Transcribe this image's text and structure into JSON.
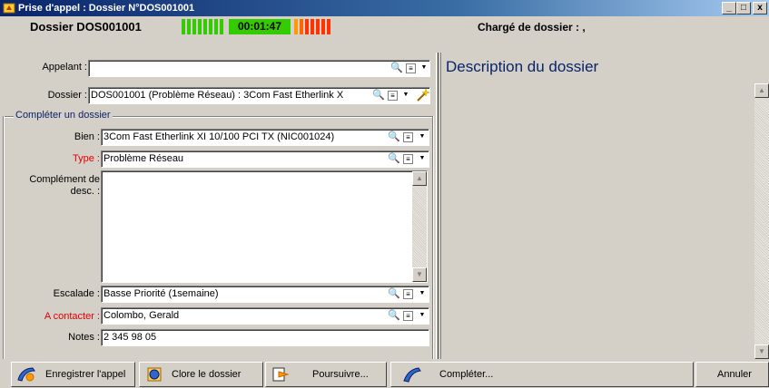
{
  "window": {
    "title": "Prise d'appel : Dossier N°DOS001001",
    "buttons": {
      "minimize": "_",
      "maximize": "□",
      "close": "x"
    }
  },
  "header": {
    "dossier_label": "Dossier DOS001001",
    "timer": "00:01:47",
    "charge_label": "Chargé de dossier : ,"
  },
  "form": {
    "appelant": {
      "label": "Appelant :",
      "value": ""
    },
    "dossier": {
      "label": "Dossier :",
      "value": "DOS001001 (Problème Réseau) : 3Com Fast Etherlink X"
    },
    "group_title": "Compléter un dossier",
    "bien": {
      "label": "Bien :",
      "value": "3Com Fast Etherlink XI 10/100 PCI TX (NIC001024)"
    },
    "type": {
      "label": "Type :",
      "value": "Problème Réseau"
    },
    "complement": {
      "label_line1": "Complément de",
      "label_line2": "desc. :",
      "value": ""
    },
    "escalade": {
      "label": "Escalade :",
      "value": "Basse Priorité (1semaine)"
    },
    "contacter": {
      "label": "A contacter :",
      "value": "Colombo, Gerald"
    },
    "notes": {
      "label": "Notes :",
      "value": "2 345 98 05"
    }
  },
  "description": {
    "title": "Description du dossier"
  },
  "toolbar": {
    "enregistrer": "Enregistrer l'appel",
    "clore": "Clore le dossier",
    "poursuivre": "Poursuivre...",
    "completer": "Compléter...",
    "annuler": "Annuler"
  },
  "colors": {
    "title_bar": "#0a246a",
    "timer_green": "#33cc00",
    "timer_red": "#ff3300",
    "required_label": "#e00000",
    "accent_text": "#0a246a"
  }
}
